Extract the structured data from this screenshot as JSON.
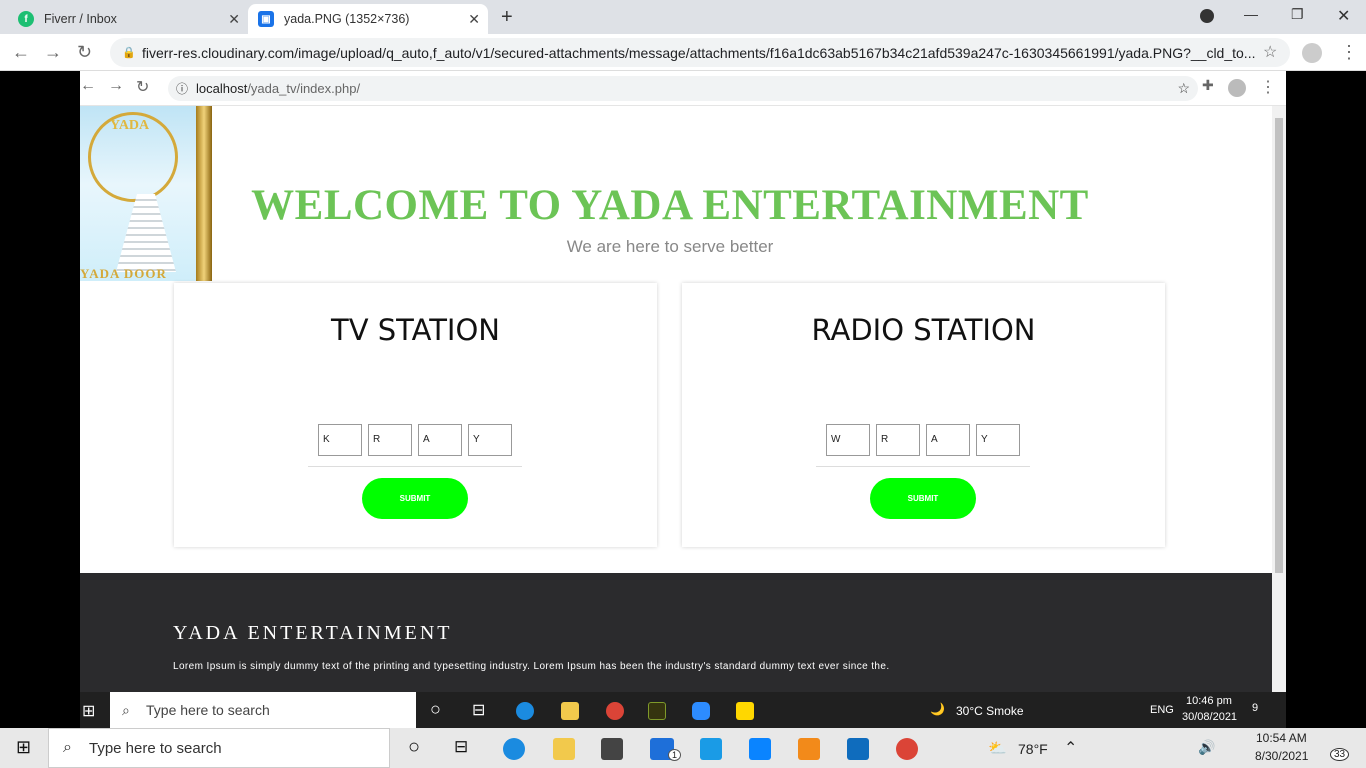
{
  "outer_browser": {
    "tabs": [
      {
        "title": "Fiverr / Inbox"
      },
      {
        "title": "yada.PNG (1352×736)"
      }
    ],
    "url": "fiverr-res.cloudinary.com/image/upload/q_auto,f_auto/v1/secured-attachments/message/attachments/f16a1dc63ab5167b34c21afd539a247c-1630345661991/yada.PNG?__cld_to..."
  },
  "inner_browser": {
    "url_host": "localhost",
    "url_path": "/yada_tv/index.php/"
  },
  "logo": {
    "top_text": "YADA",
    "bottom_text": "YADA DOOR"
  },
  "hero": {
    "title": "WELCOME TO YADA ENTERTAINMENT",
    "subtitle": "We are here to serve better"
  },
  "cards": [
    {
      "title": "TV STATION",
      "codes": [
        "K",
        "R",
        "A",
        "Y"
      ],
      "submit": "SUBMIT"
    },
    {
      "title": "RADIO STATION",
      "codes": [
        "W",
        "R",
        "A",
        "Y"
      ],
      "submit": "SUBMIT"
    }
  ],
  "footer": {
    "title": "YADA ENTERTAINMENT",
    "text": "Lorem Ipsum is simply dummy text of the printing and typesetting industry. Lorem Ipsum has been the industry's standard dummy text ever since the."
  },
  "inner_taskbar": {
    "search_placeholder": "Type here to search",
    "weather": "30°C  Smoke",
    "lang": "ENG",
    "time": "10:46 pm",
    "date": "30/08/2021",
    "notifications": "9"
  },
  "outer_taskbar": {
    "search_placeholder": "Type here to search",
    "weather": "78°F",
    "time": "10:54 AM",
    "date": "8/30/2021",
    "notifications": "33",
    "mail_badge": "1"
  },
  "colors": {
    "accent_green": "#6cc456",
    "button_green": "#00ff00",
    "footer_bg": "#2b2b2d"
  }
}
